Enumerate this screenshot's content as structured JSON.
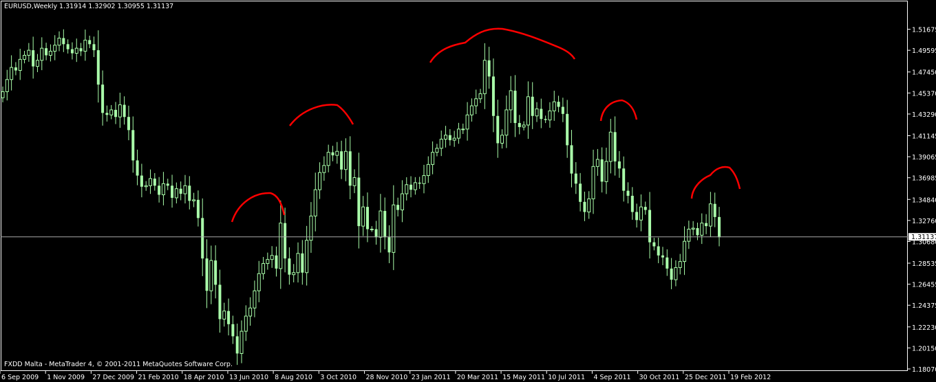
{
  "header": {
    "symbol": "EURUSD,Weekly",
    "ohlc": "1.31914 1.32902 1.30955 1.31137"
  },
  "footer": {
    "copyright": "FXDD Malta - MetaTrader 4, © 2001-2011 MetaQuotes Software Corp."
  },
  "price_label": "1.31137",
  "colors": {
    "background": "#000000",
    "candle": "#aaffaa",
    "axis": "#ffffff",
    "price_line": "#aaaaaa",
    "annotation": "#ff0000"
  },
  "chart_data": {
    "type": "candlestick",
    "timeframe": "Weekly",
    "symbol": "EURUSD",
    "grid": false,
    "ylim": [
      1.1807,
      1.5287
    ],
    "current_price": 1.31137,
    "y_ticks": [
      "1.51675",
      "1.49595",
      "1.47450",
      "1.45370",
      "1.43290",
      "1.41145",
      "1.39065",
      "1.36985",
      "1.34840",
      "1.32760",
      "1.30680",
      "1.28535",
      "1.26455",
      "1.24375",
      "1.22230",
      "1.20150",
      "1.18070"
    ],
    "x_ticks": [
      "6 Sep 2009",
      "1 Nov 2009",
      "27 Dec 2009",
      "21 Feb 2010",
      "18 Apr 2010",
      "13 Jun 2010",
      "8 Aug 2010",
      "3 Oct 2010",
      "28 Nov 2010",
      "23 Jan 2011",
      "20 Mar 2011",
      "15 May 2011",
      "10 Jul 2011",
      "4 Sep 2011",
      "30 Oct 2011",
      "25 Dec 2011",
      "19 Feb 2012"
    ],
    "closes": [
      1.455,
      1.467,
      1.479,
      1.476,
      1.487,
      1.491,
      1.496,
      1.48,
      1.486,
      1.498,
      1.491,
      1.495,
      1.501,
      1.508,
      1.502,
      1.497,
      1.493,
      1.498,
      1.495,
      1.506,
      1.502,
      1.496,
      1.462,
      1.434,
      1.432,
      1.437,
      1.43,
      1.442,
      1.43,
      1.417,
      1.387,
      1.372,
      1.361,
      1.362,
      1.369,
      1.362,
      1.353,
      1.364,
      1.362,
      1.35,
      1.359,
      1.354,
      1.362,
      1.347,
      1.348,
      1.33,
      1.29,
      1.258,
      1.288,
      1.264,
      1.23,
      1.238,
      1.225,
      1.213,
      1.196,
      1.218,
      1.233,
      1.241,
      1.258,
      1.275,
      1.285,
      1.289,
      1.293,
      1.28,
      1.325,
      1.29,
      1.274,
      1.276,
      1.295,
      1.276,
      1.308,
      1.332,
      1.358,
      1.375,
      1.382,
      1.395,
      1.392,
      1.396,
      1.378,
      1.396,
      1.362,
      1.37,
      1.322,
      1.341,
      1.319,
      1.319,
      1.311,
      1.337,
      1.311,
      1.296,
      1.343,
      1.338,
      1.354,
      1.363,
      1.358,
      1.365,
      1.364,
      1.372,
      1.383,
      1.395,
      1.399,
      1.408,
      1.412,
      1.407,
      1.409,
      1.418,
      1.418,
      1.432,
      1.441,
      1.448,
      1.453,
      1.486,
      1.47,
      1.431,
      1.404,
      1.412,
      1.437,
      1.456,
      1.424,
      1.42,
      1.422,
      1.45,
      1.431,
      1.438,
      1.428,
      1.427,
      1.436,
      1.445,
      1.44,
      1.433,
      1.402,
      1.374,
      1.364,
      1.346,
      1.336,
      1.349,
      1.381,
      1.388,
      1.366,
      1.386,
      1.415,
      1.386,
      1.379,
      1.357,
      1.352,
      1.336,
      1.328,
      1.341,
      1.338,
      1.306,
      1.302,
      1.293,
      1.291,
      1.28,
      1.269,
      1.281,
      1.287,
      1.307,
      1.319,
      1.32,
      1.313,
      1.325,
      1.322,
      1.344,
      1.331,
      1.311
    ],
    "annotations": [
      {
        "type": "freehand-arc",
        "color": "red",
        "over_date": "8 Aug 2010"
      },
      {
        "type": "freehand-arc",
        "color": "red",
        "over_date": "3 Oct 2010"
      },
      {
        "type": "freehand-arc",
        "color": "red",
        "over_date": "15 May 2011"
      },
      {
        "type": "freehand-arc",
        "color": "red",
        "over_date": "30 Oct 2011"
      },
      {
        "type": "freehand-arc",
        "color": "red",
        "over_date": "19 Feb 2012"
      }
    ]
  }
}
